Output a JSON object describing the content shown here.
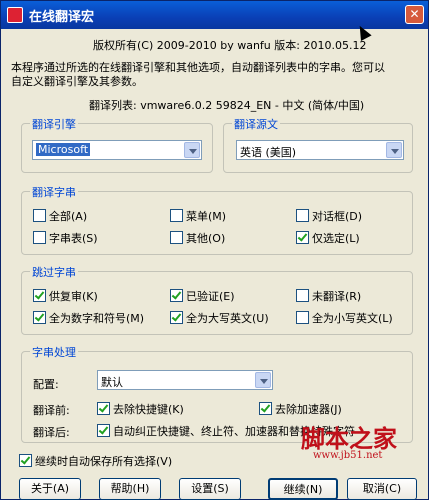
{
  "window": {
    "title": "在线翻译宏",
    "close_label": "✕"
  },
  "header": {
    "copyright": "版权所有(C) 2009-2010 by wanfu  版本: 2010.05.12",
    "description_line1": "本程序通过所选的在线翻译引擎和其他选项，自动翻译列表中的字串。您可以",
    "description_line2": "自定义翻译引擎及其参数。",
    "list_info": "翻译列表: vmware6.0.2 59824_EN - 中文 (简体/中国)"
  },
  "engine": {
    "title": "翻译引擎",
    "selected": "Microsoft"
  },
  "source": {
    "title": "翻译源文",
    "selected": "英语 (美国)"
  },
  "strings": {
    "title": "翻译字串",
    "items": [
      {
        "label": "全部(A)",
        "checked": false
      },
      {
        "label": "菜单(M)",
        "checked": false
      },
      {
        "label": "对话框(D)",
        "checked": false
      },
      {
        "label": "字串表(S)",
        "checked": false
      },
      {
        "label": "其他(O)",
        "checked": false
      },
      {
        "label": "仅选定(L)",
        "checked": true
      }
    ]
  },
  "skip": {
    "title": "跳过字串",
    "items": [
      {
        "label": "供复审(K)",
        "checked": true
      },
      {
        "label": "已验证(E)",
        "checked": true
      },
      {
        "label": "未翻译(R)",
        "checked": false
      },
      {
        "label": "全为数字和符号(M)",
        "checked": true
      },
      {
        "label": "全为大写英文(U)",
        "checked": true
      },
      {
        "label": "全为小写英文(L)",
        "checked": false
      }
    ]
  },
  "processing": {
    "title": "字串处理",
    "config_label": "配置:",
    "config_value": "默认",
    "before_label": "翻译前:",
    "before_items": [
      {
        "label": "去除快捷键(K)",
        "checked": true
      },
      {
        "label": "去除加速器(J)",
        "checked": true
      }
    ],
    "after_label": "翻译后:",
    "after_item": {
      "label": "自动纠正快捷键、终止符、加速器和替换特殊字符",
      "checked": true
    }
  },
  "autosave": {
    "label": "继续时自动保存所有选择(V)",
    "checked": true
  },
  "buttons": {
    "about": "关于(A)",
    "help": "帮助(H)",
    "settings": "设置(S)",
    "continue": "继续(N)",
    "cancel": "取消(C)"
  },
  "watermark": {
    "text": "脚本之家",
    "url": "www.jb51.net"
  }
}
